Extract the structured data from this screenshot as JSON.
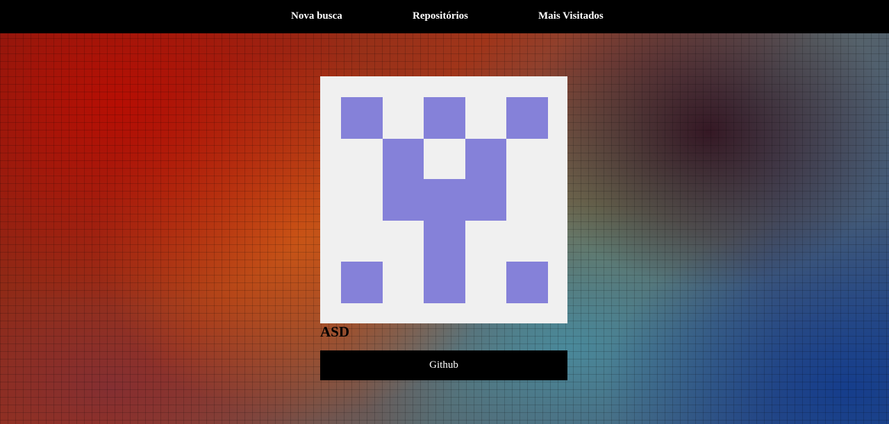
{
  "nav": {
    "items": [
      {
        "label": "Nova busca"
      },
      {
        "label": "Repositórios"
      },
      {
        "label": "Mais Visitados"
      }
    ]
  },
  "profile": {
    "name": "ASD",
    "avatar": {
      "icon": "identicon",
      "background_color": "#f0f0f0",
      "cell_color": "#8581d9"
    },
    "link_label": "Github"
  }
}
